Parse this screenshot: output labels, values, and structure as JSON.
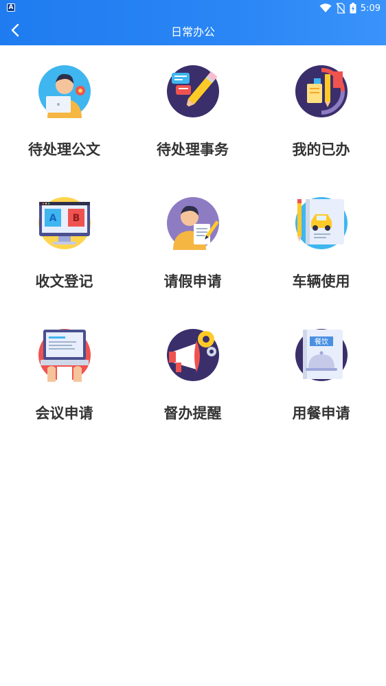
{
  "status_bar": {
    "time": "5:09",
    "app_icon_letter": "A"
  },
  "header": {
    "title": "日常办公",
    "back_icon": "chevron-left-icon"
  },
  "tiles": [
    {
      "label": "待处理公文",
      "icon": "pending-document-icon"
    },
    {
      "label": "待处理事务",
      "icon": "pending-tasks-icon"
    },
    {
      "label": "我的已办",
      "icon": "completed-items-icon"
    },
    {
      "label": "收文登记",
      "icon": "document-register-icon"
    },
    {
      "label": "请假申请",
      "icon": "leave-request-icon"
    },
    {
      "label": "车辆使用",
      "icon": "vehicle-use-icon"
    },
    {
      "label": "会议申请",
      "icon": "meeting-request-icon"
    },
    {
      "label": "督办提醒",
      "icon": "supervision-reminder-icon"
    },
    {
      "label": "用餐申请",
      "icon": "meal-request-icon",
      "badge": "餐饮"
    }
  ],
  "colors": {
    "header_start": "#1f7cf0",
    "header_end": "#3a93fb",
    "label": "#333333"
  }
}
